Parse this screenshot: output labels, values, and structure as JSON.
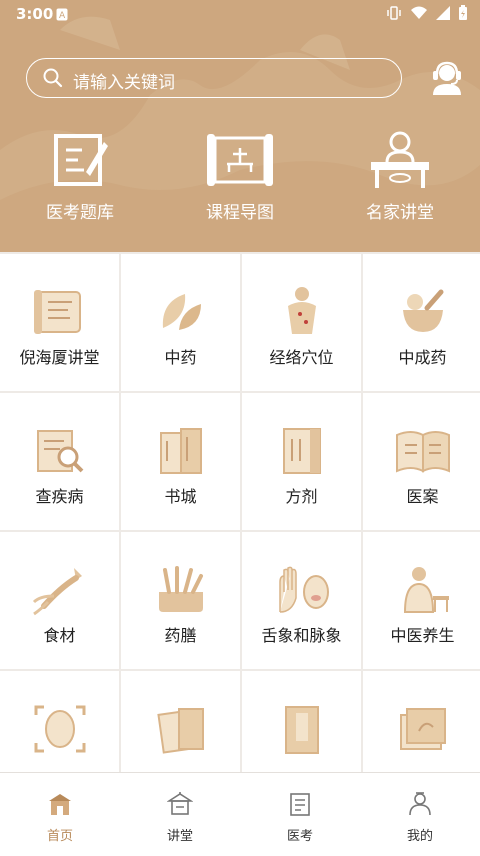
{
  "status_bar": {
    "time": "3:00"
  },
  "search": {
    "placeholder": "请输入关键词"
  },
  "top_nav": [
    {
      "label": "医考题库",
      "icon": "exam-board-icon"
    },
    {
      "label": "课程导图",
      "icon": "scroll-map-icon"
    },
    {
      "label": "名家讲堂",
      "icon": "lecturer-icon"
    }
  ],
  "grid_items": [
    {
      "label": "倪海厦讲堂"
    },
    {
      "label": "中药"
    },
    {
      "label": "经络穴位"
    },
    {
      "label": "中成药"
    },
    {
      "label": "查疾病"
    },
    {
      "label": "书城"
    },
    {
      "label": "方剂"
    },
    {
      "label": "医案"
    },
    {
      "label": "食材"
    },
    {
      "label": "药膳"
    },
    {
      "label": "舌象和脉象"
    },
    {
      "label": "中医养生"
    }
  ],
  "tab_bar": [
    {
      "label": "首页",
      "active": true
    },
    {
      "label": "讲堂"
    },
    {
      "label": "医考"
    },
    {
      "label": "我的"
    }
  ],
  "colors": {
    "accent": "#b88a5a",
    "header_bg": "#cda77f",
    "icon": "#e2c39d"
  }
}
